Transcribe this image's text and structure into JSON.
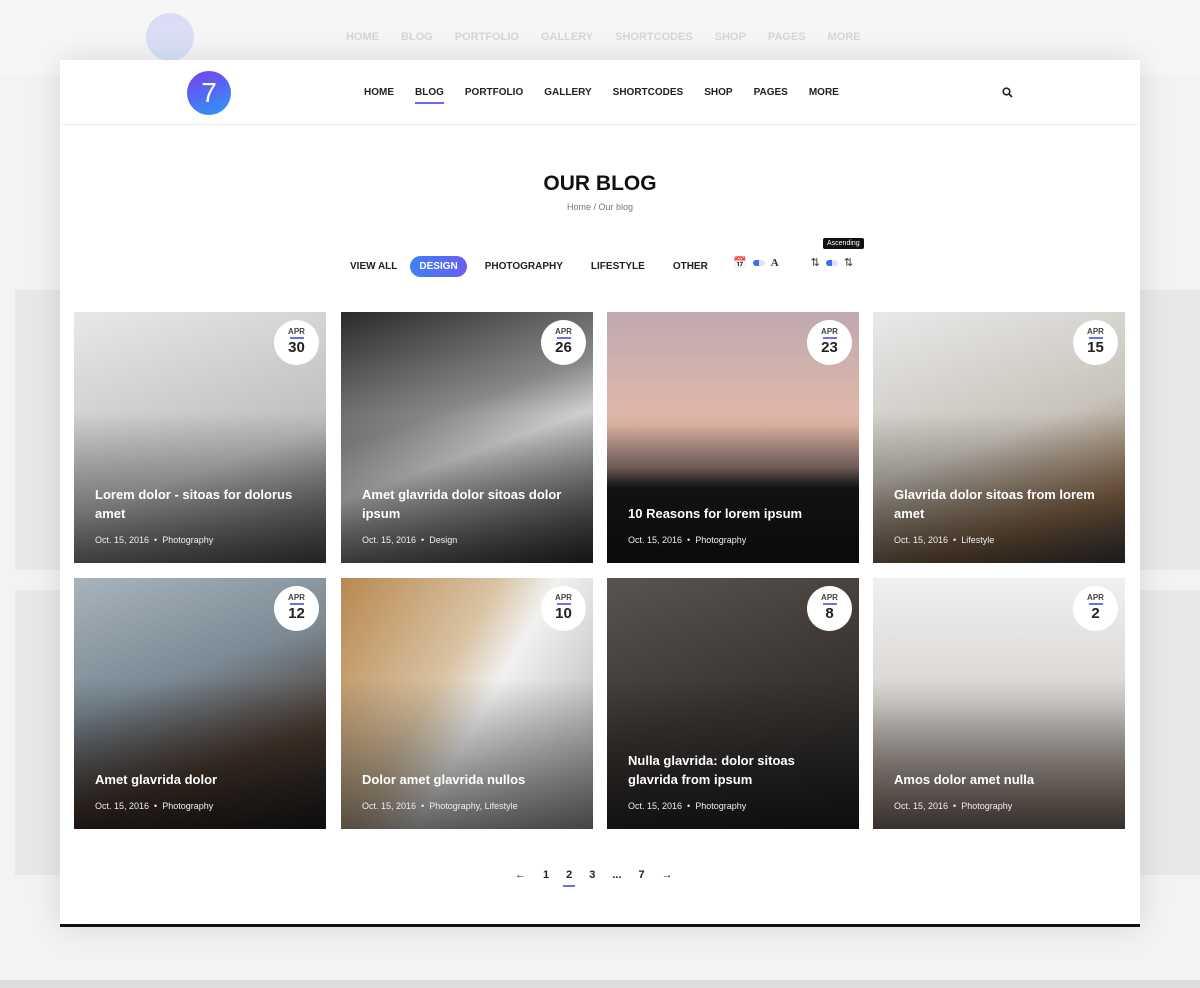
{
  "logo": "7",
  "nav": [
    "HOME",
    "BLOG",
    "PORTFOLIO",
    "GALLERY",
    "SHORTCODES",
    "SHOP",
    "PAGES",
    "MORE"
  ],
  "active_nav": "BLOG",
  "page_title": "OUR BLOG",
  "breadcrumb": {
    "home": "Home",
    "sep": "/",
    "current": "Our blog"
  },
  "filters": [
    "VIEW ALL",
    "DESIGN",
    "PHOTOGRAPHY",
    "LIFESTYLE",
    "OTHER"
  ],
  "active_filter": "DESIGN",
  "sort": {
    "date_icon": "calendar-icon",
    "alpha_label": "A",
    "tooltip": "Ascending",
    "accent": "#3b6ef5"
  },
  "posts": [
    {
      "month": "APR",
      "day": "30",
      "title": "Lorem dolor - sitoas for dolorus amet",
      "date": "Oct. 15, 2016",
      "category": "Photography",
      "bg": "linear-gradient(160deg,#e8e8e8,#bdbdbd 60%,#555)"
    },
    {
      "month": "APR",
      "day": "26",
      "title": "Amet glavrida dolor sitoas dolor ipsum",
      "date": "Oct. 15, 2016",
      "category": "Design",
      "bg": "linear-gradient(160deg,#2a2a2a,#888 40%,#cfcfcf 55%,#333)"
    },
    {
      "month": "APR",
      "day": "23",
      "title": "10 Reasons for lorem ipsum",
      "date": "Oct. 15, 2016",
      "category": "Photography",
      "bg": "linear-gradient(180deg,#bfa9b0,#e3b9a8 45%,#8d7470 62%,#1a1a1a 70%)"
    },
    {
      "month": "APR",
      "day": "15",
      "title": "Glavrida dolor sitoas from lorem amet",
      "date": "Oct. 15, 2016",
      "category": "Lifestyle",
      "bg": "linear-gradient(160deg,#e9e9e9,#c8c3bb 50%,#8a6a4a 80%,#444)"
    },
    {
      "month": "APR",
      "day": "12",
      "title": "Amet glavrida dolor",
      "date": "Oct. 15, 2016",
      "category": "Photography",
      "bg": "linear-gradient(160deg,#a8b4bd,#7a8994 40%,#4a3a30 70%,#222)"
    },
    {
      "month": "APR",
      "day": "10",
      "title": "Dolor amet glavrida nullos",
      "date": "Oct. 15, 2016",
      "category": "Photography, Lifestyle",
      "bg": "linear-gradient(120deg,#b9884f,#d9c3a3 40%,#f1f1f1 55%,#aaa)"
    },
    {
      "month": "APR",
      "day": "8",
      "title": "Nulla glavrida: dolor sitoas glavrida from ipsum",
      "date": "Oct. 15, 2016",
      "category": "Photography",
      "bg": "linear-gradient(160deg,#5a5450,#3a3532 50%,#222)"
    },
    {
      "month": "APR",
      "day": "2",
      "title": "Amos dolor amet nulla",
      "date": "Oct. 15, 2016",
      "category": "Photography",
      "bg": "linear-gradient(180deg,#f0f0f0,#d8d4d0 50%,#8a7a70)"
    }
  ],
  "pagination": {
    "prev": "←",
    "pages": [
      "1",
      "2",
      "3",
      "...",
      "7"
    ],
    "current": "2",
    "next": "→"
  }
}
